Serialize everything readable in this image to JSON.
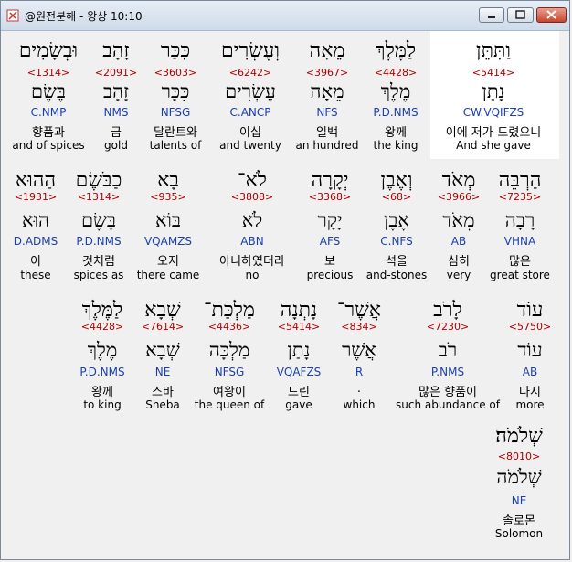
{
  "window": {
    "title": "@원전분해 - 왕상 10:10"
  },
  "rows": [
    {
      "words": [
        {
          "heb": "וַתִּתֵּן",
          "strong": "<5414>",
          "lemma": "נָתַן",
          "morph": "CW.VQIFZS",
          "kor": "이에 저가-드렸으니",
          "eng": "And she gave"
        },
        {
          "heb": "לַמֶּלֶךְ",
          "strong": "<4428>",
          "lemma": "מֶלֶךְ",
          "morph": "P.D.NMS",
          "kor": "왕께",
          "eng": "the king"
        },
        {
          "heb": "מֵאָה",
          "strong": "<3967>",
          "lemma": "מֵאָה",
          "morph": "NFS",
          "kor": "일백",
          "eng": "an hundred"
        },
        {
          "heb": "וְעֶשְׂרִים",
          "strong": "<6242>",
          "lemma": "עֶשְׂרִים",
          "morph": "C.ANCP",
          "kor": "이십",
          "eng": "and twenty"
        },
        {
          "heb": "כִּכַּר",
          "strong": "<3603>",
          "lemma": "כִּכָּר",
          "morph": "NFSG",
          "kor": "달란트와",
          "eng": "talents of"
        },
        {
          "heb": "זָהָב",
          "strong": "<2091>",
          "lemma": "זָהָב",
          "morph": "NMS",
          "kor": "금",
          "eng": "gold"
        },
        {
          "heb": "וּבְשָׂמִים",
          "strong": "<1314>",
          "lemma": "בֶּשֶׂם",
          "morph": "C.NMP",
          "kor": "향품과",
          "eng": "and of spices"
        }
      ]
    },
    {
      "words": [
        {
          "heb": "הַרְבֵּה",
          "strong": "<7235>",
          "lemma": "רָבָה",
          "morph": "VHNA",
          "kor": "많은",
          "eng": "great store"
        },
        {
          "heb": "מְאֹד",
          "strong": "<3966>",
          "lemma": "מְאֹד",
          "morph": "AB",
          "kor": "심히",
          "eng": "very"
        },
        {
          "heb": "וְאֶבֶן",
          "strong": "<68>",
          "lemma": "אֶבֶן",
          "morph": "C.NFS",
          "kor": "석을",
          "eng": "and-stones"
        },
        {
          "heb": "יְקָרָה",
          "strong": "<3368>",
          "lemma": "יָקָר",
          "morph": "AFS",
          "kor": "보",
          "eng": "precious"
        },
        {
          "heb": "לֹא־",
          "strong": "<3808>",
          "lemma": "לֹא",
          "morph": "ABN",
          "kor": "아니하였더라",
          "eng": "no"
        },
        {
          "heb": "בָא",
          "strong": "<935>",
          "lemma": "בּוֹא",
          "morph": "VQAMZS",
          "kor": "오지",
          "eng": "there came"
        },
        {
          "heb": "כַבֹּשֶׂם",
          "strong": "<1314>",
          "lemma": "בֶּשֶׂם",
          "morph": "P.D.NMS",
          "kor": "것처럼",
          "eng": "spices as"
        },
        {
          "heb": "הַהוּא",
          "strong": "<1931>",
          "lemma": "הוּא",
          "morph": "D.ADMS",
          "kor": "이",
          "eng": "these"
        }
      ]
    },
    {
      "words": [
        {
          "heb": "עוֹד",
          "strong": "<5750>",
          "lemma": "עוֹד",
          "morph": "AB",
          "kor": "다시",
          "eng": "more"
        },
        {
          "heb": "לָרֹב",
          "strong": "<7230>",
          "lemma": "רֹב",
          "morph": "P.NMS",
          "kor": "많은 향품이",
          "eng": "such abundance of"
        },
        {
          "heb": "אֲשֶׁר־",
          "strong": "<834>",
          "lemma": "אֲשֶׁר",
          "morph": "R",
          "kor": ".",
          "eng": "which"
        },
        {
          "heb": "נָתְנָה",
          "strong": "<5414>",
          "lemma": "נָתַן",
          "morph": "VQAFZS",
          "kor": "드린",
          "eng": "gave"
        },
        {
          "heb": "מַלְכַּת־",
          "strong": "<4436>",
          "lemma": "מַלְכָּה",
          "morph": "NFSG",
          "kor": "여왕이",
          "eng": "the queen of"
        },
        {
          "heb": "שְׁבָא",
          "strong": "<7614>",
          "lemma": "שְׁבָא",
          "morph": "NE",
          "kor": "스바",
          "eng": "Sheba"
        },
        {
          "heb": "לַמֶּלֶךְ",
          "strong": "<4428>",
          "lemma": "מֶלֶךְ",
          "morph": "P.D.NMS",
          "kor": "왕께",
          "eng": "to king"
        }
      ]
    },
    {
      "words": [
        {
          "heb": "שְׁלֹמֹה׃",
          "strong": "<8010>",
          "lemma": "שְׁלֹמֹה",
          "morph": "NE",
          "kor": "솔로몬",
          "eng": "Solomon"
        }
      ]
    }
  ]
}
